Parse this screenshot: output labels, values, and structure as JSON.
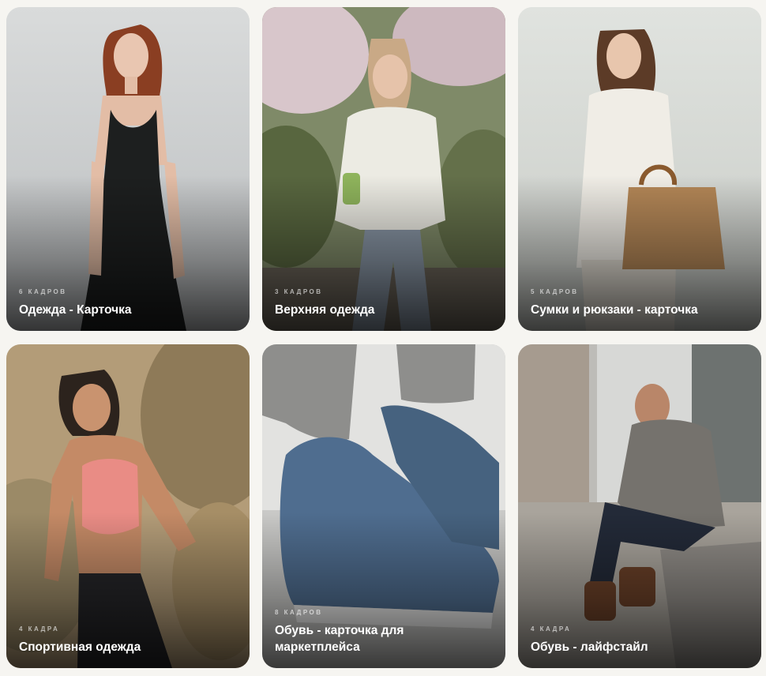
{
  "cards": [
    {
      "count": "6 кадров",
      "title": "Одежда - Карточка",
      "icon": "fashion-photo"
    },
    {
      "count": "3 кадров",
      "title": "Верхняя одежда",
      "icon": "outerwear-photo"
    },
    {
      "count": "5 кадров",
      "title": "Сумки и рюкзаки - карточка",
      "icon": "bag-photo"
    },
    {
      "count": "4 кадра",
      "title": "Спортивная одежда",
      "icon": "sportswear-photo"
    },
    {
      "count": "8 кадров",
      "title": "Обувь - карточка для маркетплейса",
      "icon": "shoes-photo"
    },
    {
      "count": "4 кадра",
      "title": "Обувь - лайфстайл",
      "icon": "lifestyle-photo"
    }
  ],
  "colors": {
    "background": "#f6f5f1",
    "caption_text": "#ffffff"
  }
}
